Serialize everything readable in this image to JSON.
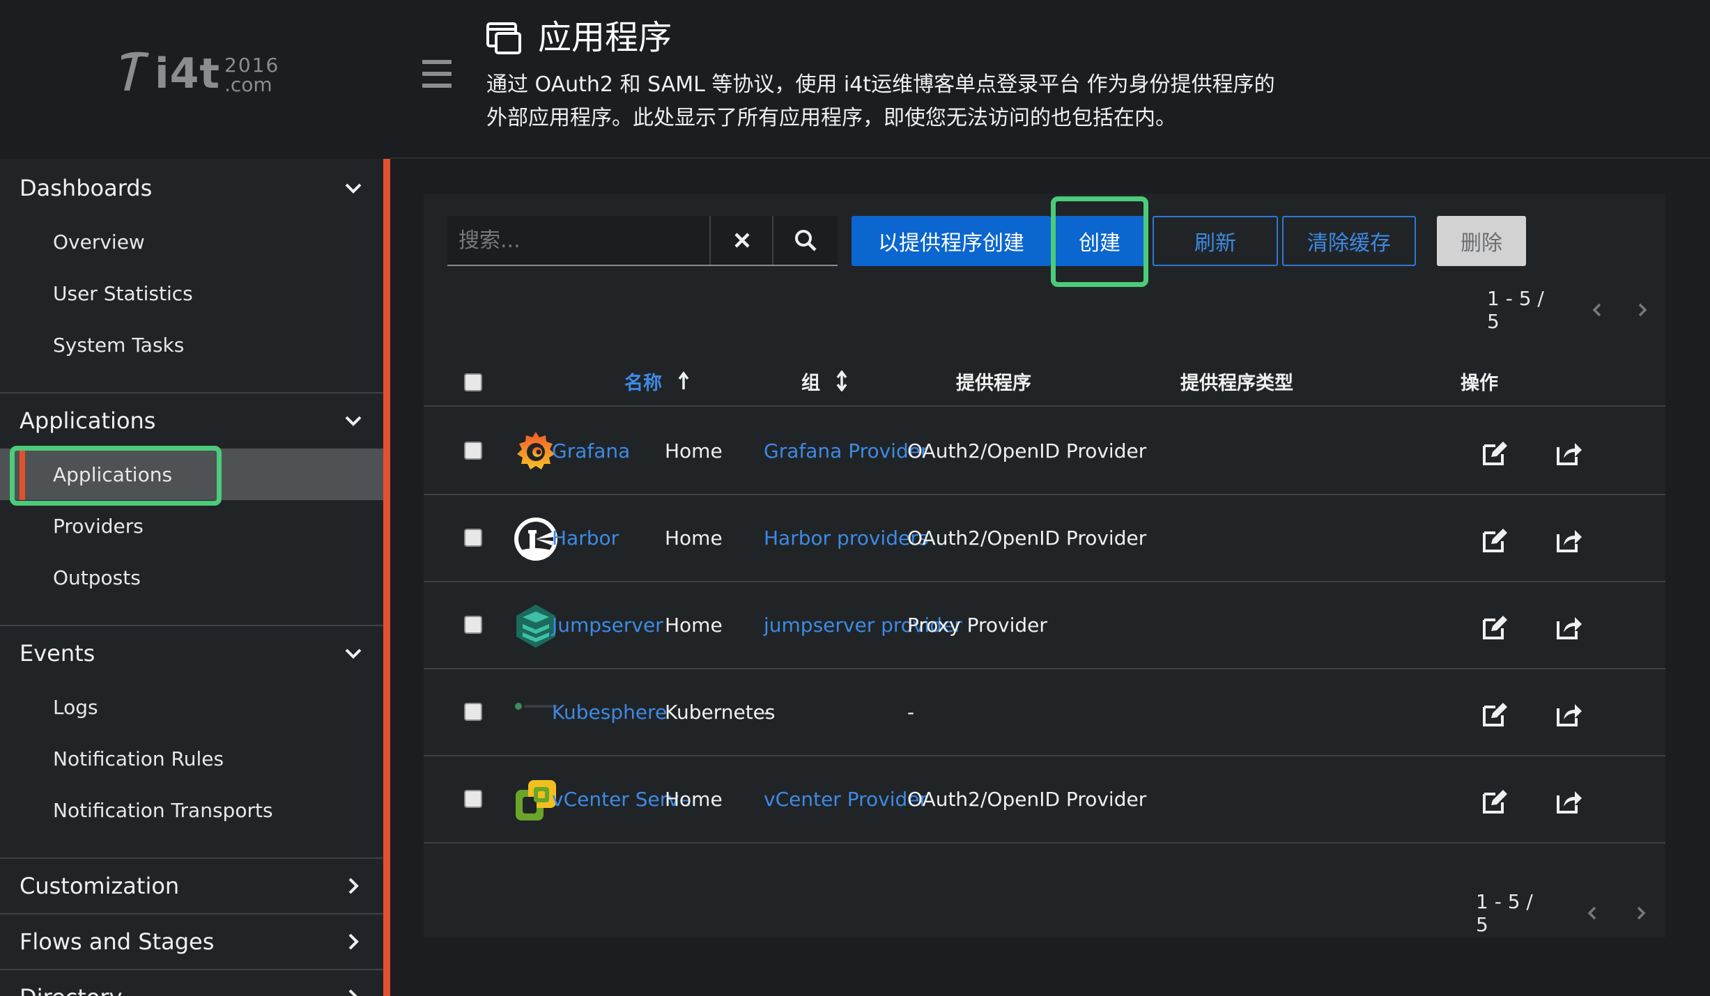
{
  "brand": {
    "logo_text": "i4t",
    "logo_year": "2016",
    "logo_domain": ".com"
  },
  "sidebar": {
    "sections": [
      {
        "label": "Dashboards",
        "expanded": true,
        "items": [
          "Overview",
          "User Statistics",
          "System Tasks"
        ]
      },
      {
        "label": "Applications",
        "expanded": true,
        "items": [
          "Applications",
          "Providers",
          "Outposts"
        ],
        "active_item": "Applications"
      },
      {
        "label": "Events",
        "expanded": true,
        "items": [
          "Logs",
          "Notification Rules",
          "Notification Transports"
        ]
      },
      {
        "label": "Customization",
        "expanded": false,
        "items": []
      },
      {
        "label": "Flows and Stages",
        "expanded": false,
        "items": []
      },
      {
        "label": "Directory",
        "expanded": false,
        "items": []
      }
    ]
  },
  "header": {
    "title": "应用程序",
    "description": "通过 OAuth2 和 SAML 等协议，使用 i4t运维博客单点登录平台 作为身份提供程序的外部应用程序。此处显示了所有应用程序，即使您无法访问的也包括在内。"
  },
  "toolbar": {
    "search_placeholder": "搜索...",
    "create_with_provider": "以提供程序创建",
    "create": "创建",
    "refresh": "刷新",
    "clear_cache": "清除缓存",
    "delete": "删除"
  },
  "pagination": {
    "top": "1 - 5 / 5",
    "bottom": "1 - 5 / 5"
  },
  "table": {
    "columns": [
      "名称",
      "组",
      "提供程序",
      "提供程序类型",
      "操作"
    ],
    "rows": [
      {
        "name": "Grafana",
        "group": "Home",
        "provider": "Grafana Provider",
        "provider_type": "OAuth2/OpenID Provider",
        "icon": "grafana-icon"
      },
      {
        "name": "Harbor",
        "group": "Home",
        "provider": "Harbor providers",
        "provider_type": "OAuth2/OpenID Provider",
        "icon": "harbor-icon"
      },
      {
        "name": "Jumpserver",
        "group": "Home",
        "provider": "jumpserver provider",
        "provider_type": "Proxy Provider",
        "icon": "jumpserver-icon"
      },
      {
        "name": "Kubesphere",
        "group": "Kubernetes",
        "provider": "-",
        "provider_type": "-",
        "icon": "kubesphere-icon"
      },
      {
        "name": "vCenter Server",
        "group": "Home",
        "provider": "vCenter Provider",
        "provider_type": "OAuth2/OpenID Provider",
        "icon": "vcenter-icon"
      }
    ]
  },
  "colors": {
    "accent": "#0b66cf",
    "link": "#3d8ae4",
    "highlight": "#4ccb7a",
    "active_bar": "#e2512f"
  }
}
